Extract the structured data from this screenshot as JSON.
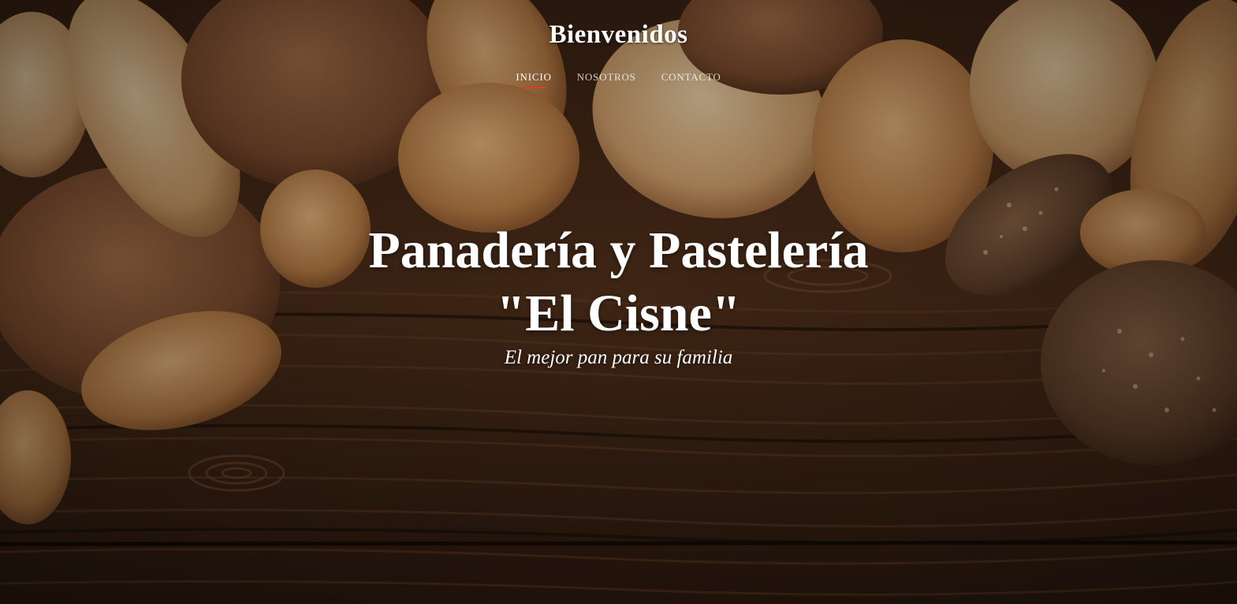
{
  "header": {
    "site_title": "Bienvenidos"
  },
  "nav": {
    "items": [
      {
        "label": "INICIO",
        "active": true
      },
      {
        "label": "NOSOTROS",
        "active": false
      },
      {
        "label": "CONTACTO",
        "active": false
      }
    ],
    "active_underline_color": "#d4421f"
  },
  "hero": {
    "headline_line1": "Panadería y Pastelería",
    "headline_line2": "\"El Cisne\"",
    "tagline": "El mejor pan para su familia",
    "background_image": "bread-on-wood-photo"
  },
  "colors": {
    "text": "#ffffff",
    "wood": "#4a2c18",
    "bread": "#c89256"
  }
}
